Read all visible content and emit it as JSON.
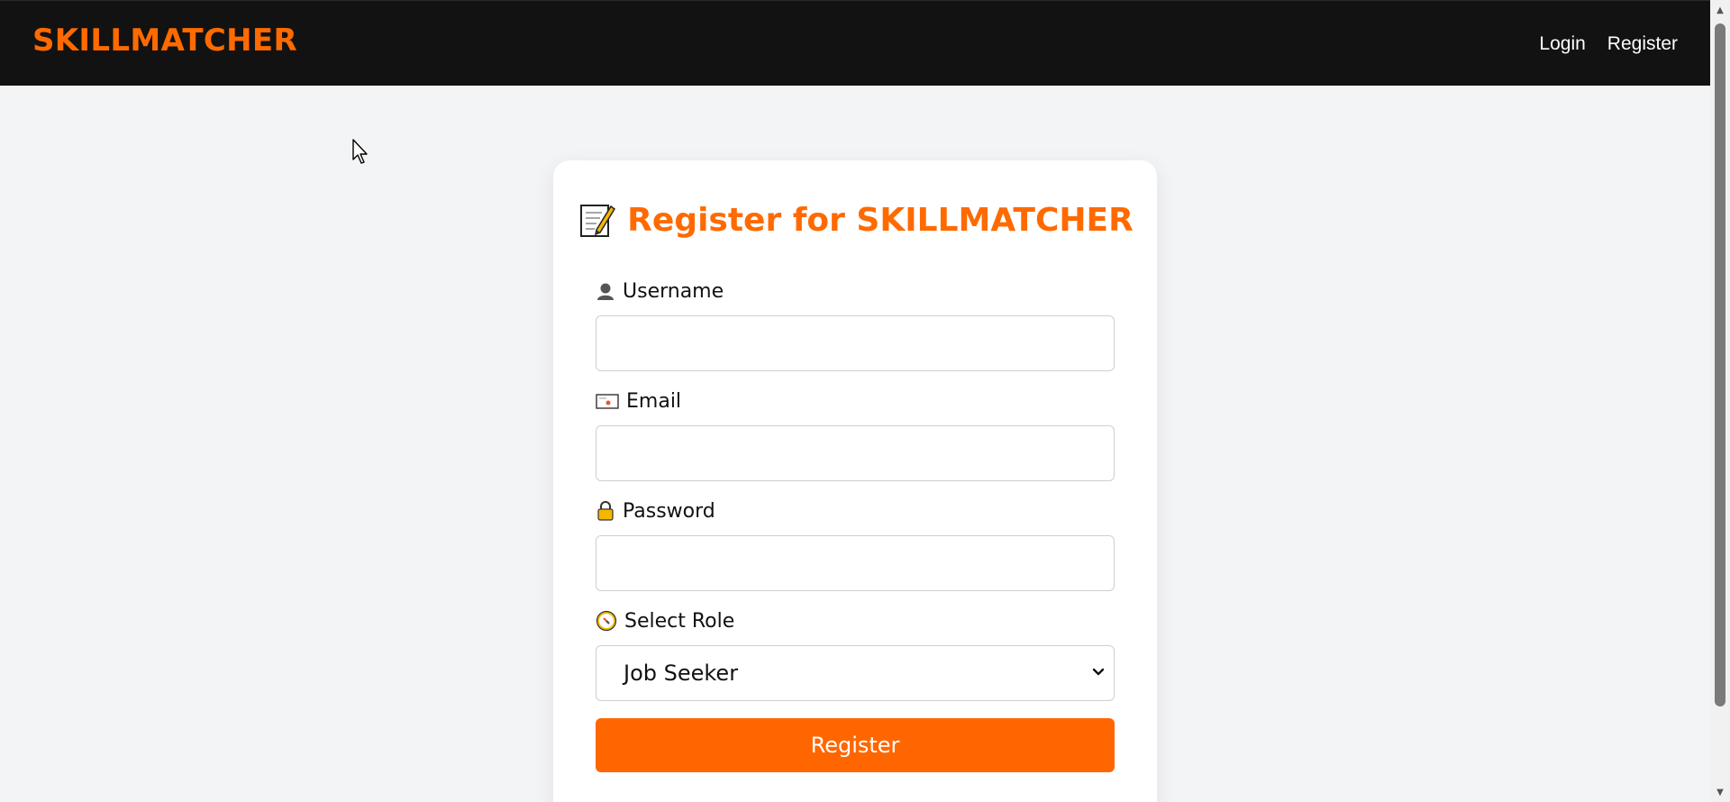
{
  "navbar": {
    "brand": "SKILLMATCHER",
    "links": [
      {
        "label": "Login"
      },
      {
        "label": "Register"
      }
    ]
  },
  "form": {
    "title": "Register for SKILLMATCHER",
    "title_icon": "memo-icon",
    "fields": [
      {
        "label": "Username",
        "icon": "user-icon",
        "value": ""
      },
      {
        "label": "Email",
        "icon": "envelope-icon",
        "value": ""
      },
      {
        "label": "Password",
        "icon": "lock-icon",
        "value": ""
      }
    ],
    "role": {
      "label": "Select Role",
      "icon": "compass-icon",
      "selected": "Job Seeker"
    },
    "submit_label": "Register"
  },
  "colors": {
    "accent": "#ff6600",
    "navbar_bg": "#121212",
    "page_bg": "#f3f4f6"
  }
}
